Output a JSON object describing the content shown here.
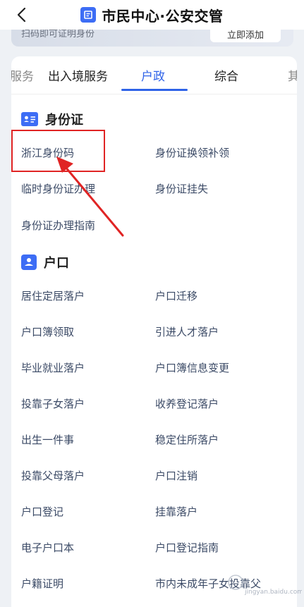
{
  "header": {
    "title": "市民中心·公安交管"
  },
  "banner": {
    "text": "扫码即可证明身份",
    "button_label": "立即添加"
  },
  "tabs": [
    {
      "label": "服务"
    },
    {
      "label": "出入境服务"
    },
    {
      "label": "户政",
      "active": true
    },
    {
      "label": "综合"
    },
    {
      "label": "其"
    }
  ],
  "sections": {
    "id_card": {
      "title": "身份证",
      "items": [
        "浙江身份码",
        "身份证换领补领",
        "临时身份证办理",
        "身份证挂失",
        "身份证办理指南"
      ]
    },
    "household": {
      "title": "户口",
      "items": [
        "居住定居落户",
        "户口迁移",
        "户口簿领取",
        "引进人才落户",
        "毕业就业落户",
        "户口簿信息变更",
        "投靠子女落户",
        "收养登记落户",
        "出生一件事",
        "稳定住所落户",
        "投靠父母落户",
        "户口注销",
        "户口登记",
        "挂靠落户",
        "电子户口本",
        "户口登记指南",
        "户籍证明",
        "市内未成年子女投靠父"
      ]
    }
  },
  "watermark": {
    "text": "jingyan.baidu.com"
  },
  "colors": {
    "accent": "#2f63e8",
    "annotation": "#e02424",
    "item_text": "#3b4a66"
  }
}
